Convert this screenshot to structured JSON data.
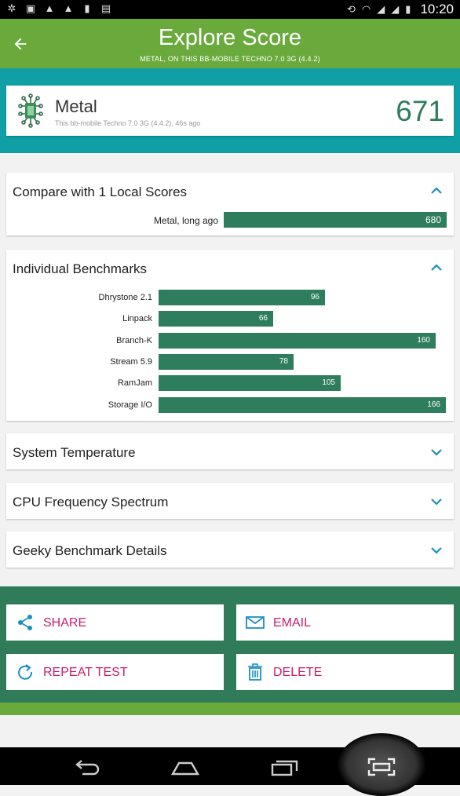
{
  "status_bar": {
    "time": "10:20",
    "left_icons": [
      "usb-icon",
      "image-icon",
      "warning-icon",
      "warning-icon",
      "lock-icon",
      "clipboard-icon"
    ],
    "right_icons": [
      "rotate-icon",
      "wifi-icon",
      "signal-icon",
      "signal-icon",
      "battery-icon"
    ]
  },
  "header": {
    "title": "Explore Score",
    "subtitle": "METAL, ON THIS BB-MOBILE TECHNO 7.0 3G (4.4.2)"
  },
  "score_card": {
    "name": "Metal",
    "description": "This bb-mobile Techno 7.0 3G (4.4.2), 46s ago",
    "score": "671"
  },
  "compare": {
    "title": "Compare with 1 Local Scores",
    "rows": [
      {
        "label": "Metal, long ago",
        "value": "680",
        "fraction": 1.0
      }
    ]
  },
  "benchmarks": {
    "title": "Individual Benchmarks",
    "max": 166,
    "rows": [
      {
        "label": "Dhrystone 2.1",
        "value": "96"
      },
      {
        "label": "Linpack",
        "value": "66"
      },
      {
        "label": "Branch-K",
        "value": "160"
      },
      {
        "label": "Stream 5.9",
        "value": "78"
      },
      {
        "label": "RamJam",
        "value": "105"
      },
      {
        "label": "Storage I/O",
        "value": "166"
      }
    ]
  },
  "sections": [
    {
      "title": "System Temperature"
    },
    {
      "title": "CPU Frequency Spectrum"
    },
    {
      "title": "Geeky Benchmark Details"
    }
  ],
  "actions": {
    "share": "SHARE",
    "email": "EMAIL",
    "repeat": "REPEAT TEST",
    "delete": "DELETE"
  },
  "colors": {
    "app_bar": "#6aaa3c",
    "teal": "#109fa5",
    "bar": "#2e7d5c",
    "action_band": "#307c58",
    "action_text": "#c51f6b",
    "accent_icon": "#1a8fc0"
  }
}
